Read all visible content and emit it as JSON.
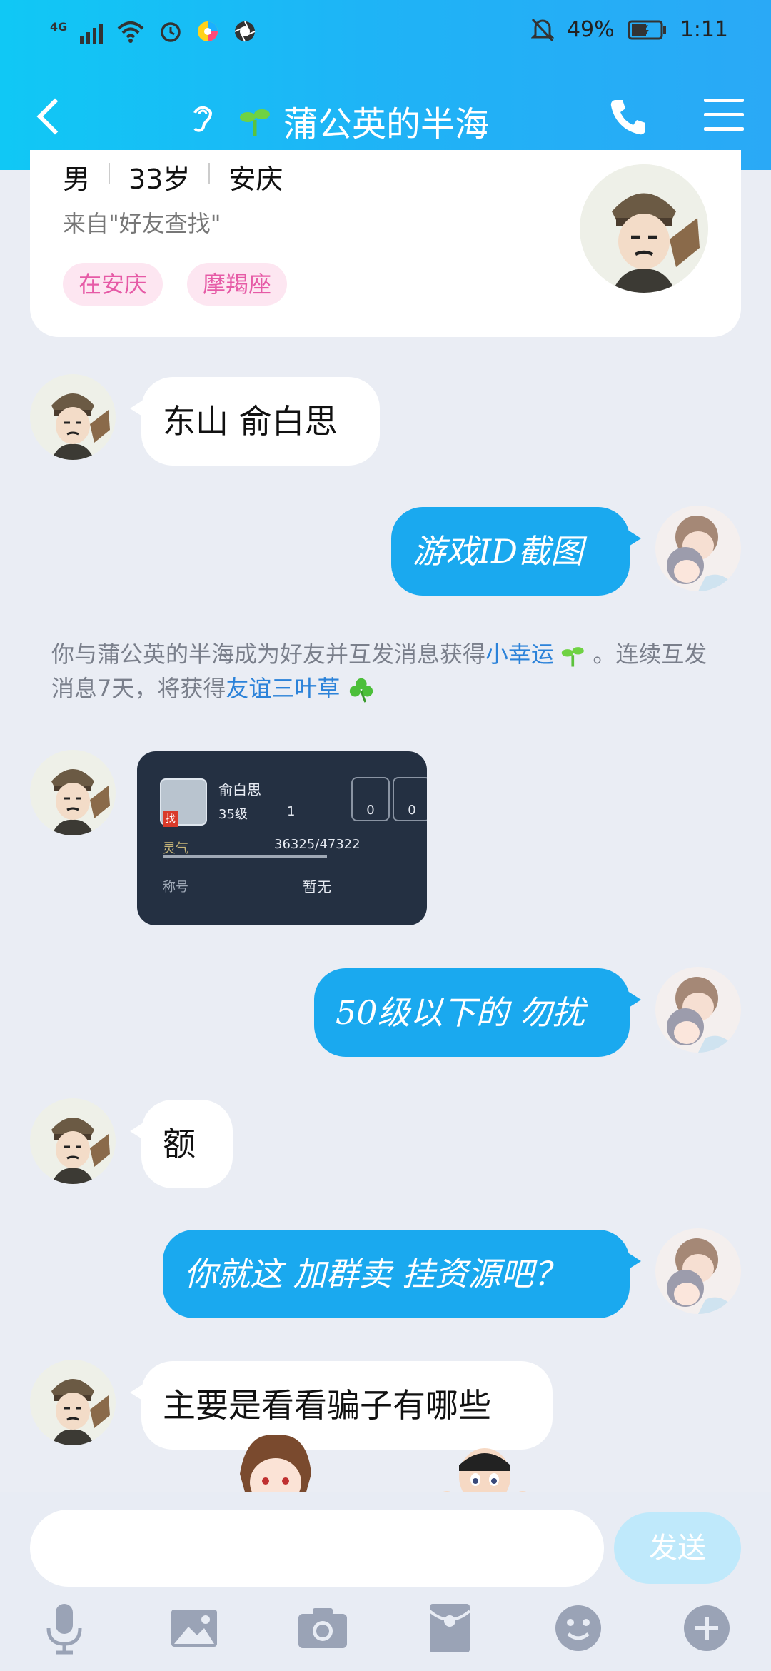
{
  "status_bar": {
    "network": "4G",
    "battery": "49%",
    "time": "1:11"
  },
  "header": {
    "title": "蒲公英的半海"
  },
  "profile": {
    "gender": "男",
    "age": "33岁",
    "city": "安庆",
    "source": "来自\"好友查找\"",
    "tags": [
      "在安庆",
      "摩羯座"
    ]
  },
  "messages": [
    {
      "side": "in",
      "text": "东山 俞白思"
    },
    {
      "side": "out",
      "text": "游戏ID截图"
    },
    {
      "side": "out",
      "text": "50级以下的 勿扰"
    },
    {
      "side": "in",
      "text": "额"
    },
    {
      "side": "out",
      "text": "你就这 加群卖 挂资源吧？"
    },
    {
      "side": "in",
      "text": "主要是看看骗子有哪些"
    }
  ],
  "system_message": {
    "part1": "你与蒲公英的半海成为好友并互发消息获得",
    "link1": "小幸运",
    "part2": " 。连续互发消息7天，将获得",
    "link2": "友谊三叶草"
  },
  "image_card": {
    "name": "俞白思",
    "level": "35级",
    "house": "1",
    "badge": "找",
    "stat1": "0",
    "stat2": "0",
    "lingqi_label": "灵气",
    "lingqi_value": "36325/47322",
    "title_label": "称号",
    "title_value": "暂无"
  },
  "input_bar": {
    "send_label": "发送"
  },
  "toolbar": {
    "icons": [
      "microphone-icon",
      "image-icon",
      "camera-icon",
      "red-packet-icon",
      "emoji-icon",
      "plus-icon"
    ]
  }
}
